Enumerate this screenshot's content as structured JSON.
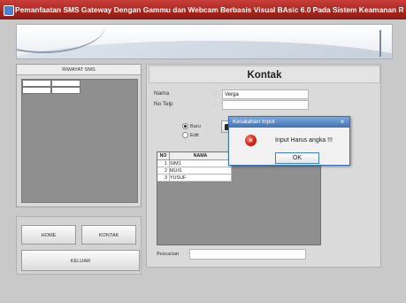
{
  "window": {
    "title": "Pemanfaatan SMS Gateway Dengan Gammu dan Webcam Berbasis Visual BAsic 6.0 Pada Sistem Keamanan R...."
  },
  "left_panel": {
    "header": "RIWAYAT SMS",
    "buttons": {
      "home": "HOME",
      "kontak": "KONTAK",
      "keluar": "KELUAR"
    }
  },
  "kontak": {
    "title": "Kontak",
    "nama_label": "Nama",
    "nama_value": "Verga",
    "telp_label": "No Telp",
    "telp_value": "",
    "radio_baru": "Baru",
    "radio_edit": "Edit",
    "save_fragment": "S",
    "table": {
      "headers": [
        "NO",
        "NAMA"
      ],
      "rows": [
        [
          "1",
          "SIM1"
        ],
        [
          "2",
          "MUIS"
        ],
        [
          "3",
          "YUSUF"
        ]
      ]
    },
    "search_label": "Pencarian",
    "search_value": ""
  },
  "dialog": {
    "title": "Kesalahan Input",
    "close": "×",
    "message": "Input Harus angka !!!",
    "ok": "OK",
    "icon": "error-icon"
  }
}
